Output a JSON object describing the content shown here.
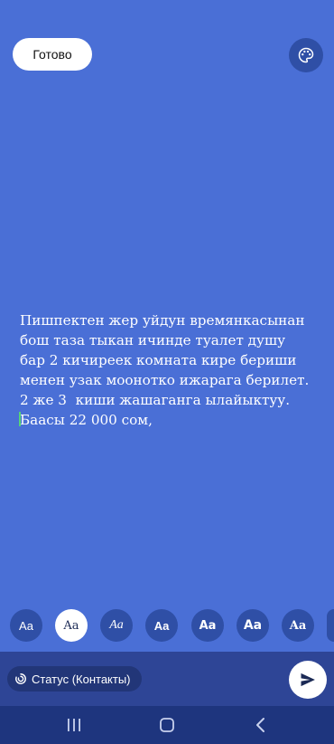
{
  "header": {
    "done_label": "Готово",
    "palette_icon": "palette-icon"
  },
  "status": {
    "lines": "Пишпектен жер уйдун времянкасынан\nбош таза тыкан ичинде туалет душу\nбар 2 кичиреек комната кире бериши\nменен узак моонотко ижарага берилет.\n2 же 3  киши жашаганга ылайыктуу.\nБаасы 22 000 сом,",
    "background_color": "#4a6fd6"
  },
  "font_options": [
    {
      "label": "Aa",
      "style": "sans"
    },
    {
      "label": "Aa",
      "style": "serif",
      "selected": true
    },
    {
      "label": "Aa",
      "style": "italic"
    },
    {
      "label": "Aa",
      "style": "bold"
    },
    {
      "label": "Aa",
      "style": "bold-wide"
    },
    {
      "label": "Aa",
      "style": "heavy"
    },
    {
      "label": "Aa",
      "style": "condensed-bold"
    },
    {
      "label": "Aa",
      "style": "partial"
    }
  ],
  "footer": {
    "audience_label": "Статус (Контакты)",
    "audience_icon": "status-ring-icon",
    "send_icon": "send-icon"
  },
  "nav": {
    "recents_icon": "recents-icon",
    "home_icon": "home-icon",
    "back_icon": "back-icon"
  }
}
